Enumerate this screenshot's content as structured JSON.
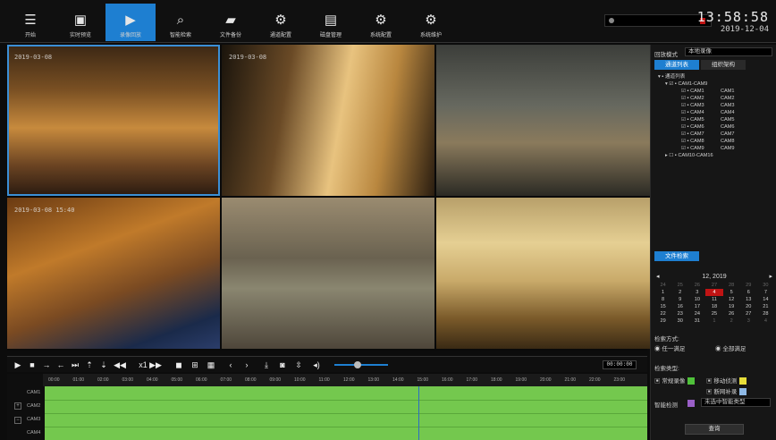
{
  "nav": [
    {
      "label": "开始",
      "icon": "menu-icon"
    },
    {
      "label": "实时预览",
      "icon": "live-view-icon"
    },
    {
      "label": "录像回放",
      "icon": "playback-icon"
    },
    {
      "label": "智能检索",
      "icon": "smart-search-icon"
    },
    {
      "label": "文件备份",
      "icon": "folder-icon"
    },
    {
      "label": "通道配置",
      "icon": "channel-config-icon"
    },
    {
      "label": "磁盘管理",
      "icon": "disk-icon"
    },
    {
      "label": "系统配置",
      "icon": "system-config-icon"
    },
    {
      "label": "系统维护",
      "icon": "gear-icon"
    }
  ],
  "active_nav": "录像回放",
  "clock": {
    "time": "13:58:58",
    "date": "2019-12-04"
  },
  "cameras": [
    {
      "timestamp": "2019-03-08 "
    },
    {
      "timestamp": "2019-03-08"
    },
    {
      "timestamp": ""
    },
    {
      "timestamp": "2019-03-08  15:40"
    },
    {
      "timestamp": ""
    },
    {
      "timestamp": ""
    }
  ],
  "panel": {
    "mode_label": "回放模式",
    "mode_value": "本地录像",
    "tabs": [
      "通道列表",
      "组织架构"
    ],
    "tree_root": "通道列表",
    "group_1": "CAM1-CAM9",
    "channels": [
      {
        "name": "CAM1",
        "alias": "CAM1"
      },
      {
        "name": "CAM2",
        "alias": "CAM2"
      },
      {
        "name": "CAM3",
        "alias": "CAM3"
      },
      {
        "name": "CAM4",
        "alias": "CAM4"
      },
      {
        "name": "CAM5",
        "alias": "CAM5"
      },
      {
        "name": "CAM6",
        "alias": "CAM6"
      },
      {
        "name": "CAM7",
        "alias": "CAM7"
      },
      {
        "name": "CAM8",
        "alias": "CAM8"
      },
      {
        "name": "CAM9",
        "alias": "CAM9"
      }
    ],
    "group_2": "CAM10-CAM16",
    "file_search_tab": "文件检索",
    "calendar": {
      "month": "12",
      "year": "2019",
      "weeks": [
        [
          {
            "d": "24",
            "m": false
          },
          {
            "d": "25",
            "m": false
          },
          {
            "d": "26",
            "m": false
          },
          {
            "d": "27",
            "m": false
          },
          {
            "d": "28",
            "m": false
          },
          {
            "d": "29",
            "m": false
          },
          {
            "d": "30",
            "m": false
          }
        ],
        [
          {
            "d": "1",
            "m": true
          },
          {
            "d": "2",
            "m": true
          },
          {
            "d": "3",
            "m": true
          },
          {
            "d": "4",
            "m": true,
            "today": true
          },
          {
            "d": "5",
            "m": true
          },
          {
            "d": "6",
            "m": true
          },
          {
            "d": "7",
            "m": true
          }
        ],
        [
          {
            "d": "8",
            "m": true
          },
          {
            "d": "9",
            "m": true
          },
          {
            "d": "10",
            "m": true
          },
          {
            "d": "11",
            "m": true
          },
          {
            "d": "12",
            "m": true
          },
          {
            "d": "13",
            "m": true
          },
          {
            "d": "14",
            "m": true
          }
        ],
        [
          {
            "d": "15",
            "m": true
          },
          {
            "d": "16",
            "m": true
          },
          {
            "d": "17",
            "m": true
          },
          {
            "d": "18",
            "m": true
          },
          {
            "d": "19",
            "m": true
          },
          {
            "d": "20",
            "m": true
          },
          {
            "d": "21",
            "m": true
          }
        ],
        [
          {
            "d": "22",
            "m": true
          },
          {
            "d": "23",
            "m": true
          },
          {
            "d": "24",
            "m": true
          },
          {
            "d": "25",
            "m": true
          },
          {
            "d": "26",
            "m": true
          },
          {
            "d": "27",
            "m": true
          },
          {
            "d": "28",
            "m": true
          }
        ],
        [
          {
            "d": "29",
            "m": true
          },
          {
            "d": "30",
            "m": true
          },
          {
            "d": "31",
            "m": true
          },
          {
            "d": "1",
            "m": false
          },
          {
            "d": "2",
            "m": false
          },
          {
            "d": "3",
            "m": false
          },
          {
            "d": "4",
            "m": false
          }
        ]
      ]
    },
    "search_method_label": "检索方式:",
    "method_any": "任一满足",
    "method_all": "全部满足",
    "search_type_label": "检索类型:",
    "type_normal": "常规录像",
    "type_motion": "移动侦测",
    "type_disconnect": "断网补录",
    "type_smart": "智能检测",
    "smart_select": "未选中智能类型",
    "query_button": "查询",
    "colors": {
      "normal": "#4fc13a",
      "motion": "#e6dd3a",
      "disconnect": "#8fb9e6",
      "smart": "#9a5fc7"
    }
  },
  "control": {
    "time_value": "00:00:00"
  },
  "timeline": {
    "hours": [
      "00:00",
      "01:00",
      "02:00",
      "03:00",
      "04:00",
      "05:00",
      "06:00",
      "07:00",
      "08:00",
      "09:00",
      "10:00",
      "11:00",
      "12:00",
      "13:00",
      "14:00",
      "15:00",
      "16:00",
      "17:00",
      "18:00",
      "19:00",
      "20:00",
      "21:00",
      "22:00",
      "23:00"
    ],
    "tracks": [
      "CAM1",
      "CAM2",
      "CAM3",
      "CAM4"
    ],
    "record_color": "#74c84e"
  }
}
